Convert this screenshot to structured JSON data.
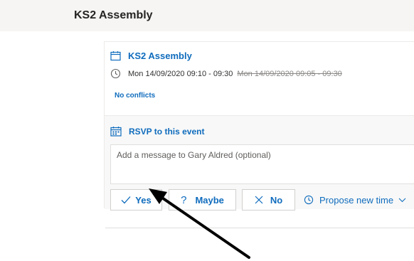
{
  "header": {
    "title": "KS2 Assembly"
  },
  "event": {
    "title": "KS2 Assembly",
    "time_new": "Mon 14/09/2020 09:10 - 09:30",
    "time_old": "Mon 14/09/2020 09:05 - 09:30",
    "conflicts": "No conflicts"
  },
  "rsvp": {
    "label": "RSVP to this event",
    "message_placeholder": "Add a message to Gary Aldred (optional)",
    "buttons": {
      "yes": "Yes",
      "maybe": "Maybe",
      "no": "No",
      "propose": "Propose new time"
    }
  },
  "icons": {
    "calendar": "calendar-icon",
    "clock": "clock-icon",
    "rsvp_calendar": "calendar-grid-icon",
    "yes": "checkmark-icon",
    "maybe": "question-mark-icon",
    "no": "close-icon",
    "propose": "clock-icon",
    "chevron": "chevron-down-icon",
    "annotation": "arrow-annotation"
  },
  "colors": {
    "accent": "#0f6cbd",
    "header_bg": "#f6f5f4",
    "panel_bg": "#f8f8f8",
    "text": "#323130"
  }
}
